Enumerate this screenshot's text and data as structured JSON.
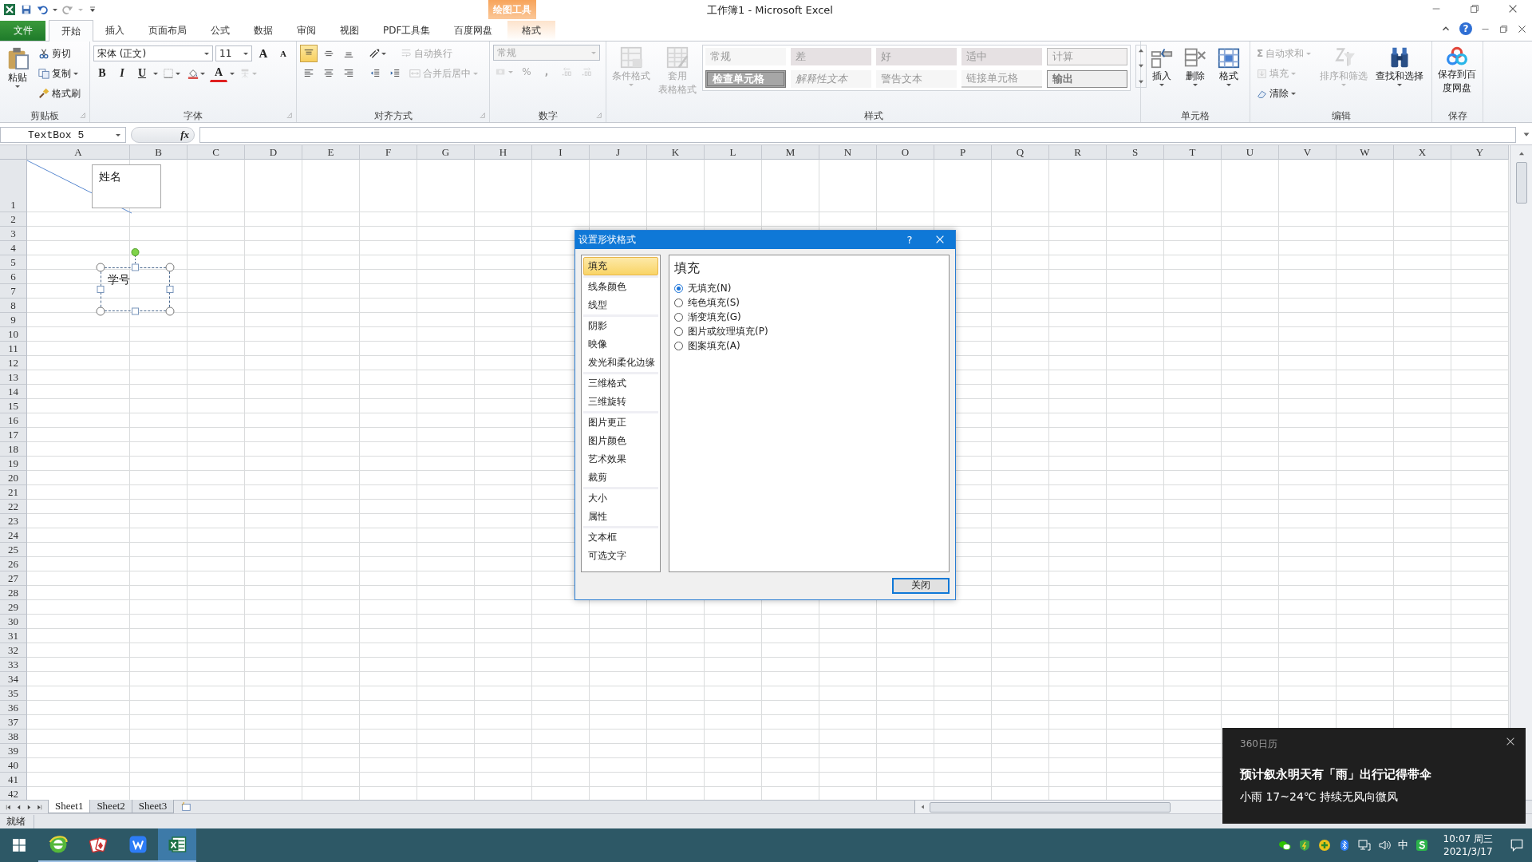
{
  "title_bar": {
    "title": "工作簿1 - Microsoft Excel",
    "contextual_header": "绘图工具",
    "help_label": "?"
  },
  "ribbon_tabs": [
    {
      "label": "文件",
      "kind": "file",
      "selected": false
    },
    {
      "label": "开始",
      "kind": "tab",
      "selected": true
    },
    {
      "label": "插入",
      "kind": "tab",
      "selected": false
    },
    {
      "label": "页面布局",
      "kind": "tab",
      "selected": false
    },
    {
      "label": "公式",
      "kind": "tab",
      "selected": false
    },
    {
      "label": "数据",
      "kind": "tab",
      "selected": false
    },
    {
      "label": "审阅",
      "kind": "tab",
      "selected": false
    },
    {
      "label": "视图",
      "kind": "tab",
      "selected": false
    },
    {
      "label": "PDF工具集",
      "kind": "tab",
      "selected": false
    },
    {
      "label": "百度网盘",
      "kind": "tab",
      "selected": false
    },
    {
      "label": "格式",
      "kind": "contextual",
      "selected": false
    }
  ],
  "clipboard": {
    "label": "剪贴板",
    "paste": "粘贴",
    "cut": "剪切",
    "copy": "复制",
    "format_painter": "格式刷"
  },
  "font": {
    "label": "字体",
    "font_name": "宋体 (正文)",
    "font_size": "11",
    "grow": "A",
    "shrink": "A",
    "font_color": "A",
    "phonetic_disabled": true,
    "styles": [
      {
        "label": "B",
        "kind": "bold"
      },
      {
        "label": "I",
        "kind": "italic"
      },
      {
        "label": "U",
        "kind": "underline"
      }
    ]
  },
  "alignment": {
    "label": "对齐方式",
    "vertical": [
      {
        "kind": "top",
        "selected": true
      },
      {
        "kind": "middle",
        "selected": false
      },
      {
        "kind": "bottom",
        "selected": false
      }
    ],
    "horizontal": [
      {
        "kind": "left",
        "selected": false
      },
      {
        "kind": "center",
        "selected": false
      },
      {
        "kind": "right",
        "selected": false
      }
    ],
    "wrap_text": {
      "label": "自动换行",
      "disabled": true
    },
    "merge_center": {
      "label": "合并后居中",
      "disabled": true
    }
  },
  "number": {
    "label": "数字",
    "format": "常规",
    "percent": "%",
    "comma": ",",
    "disabled": true
  },
  "styles": {
    "label": "样式",
    "conditional_format": "条件格式",
    "table_format_lines": [
      "套用",
      "表格格式"
    ],
    "disabled": true,
    "cell_styles": [
      {
        "label": "常规",
        "kind": "normal"
      },
      {
        "label": "差",
        "kind": "bad"
      },
      {
        "label": "好",
        "kind": "good"
      },
      {
        "label": "适中",
        "kind": "neutral"
      },
      {
        "label": "计算",
        "kind": "calculation"
      },
      {
        "label": "检查单元格",
        "kind": "check"
      },
      {
        "label": "解释性文本",
        "kind": "explanatory"
      },
      {
        "label": "警告文本",
        "kind": "warning"
      },
      {
        "label": "链接单元格",
        "kind": "linked"
      },
      {
        "label": "输出",
        "kind": "output"
      }
    ]
  },
  "cells": {
    "label": "单元格",
    "buttons": [
      {
        "label": "插入",
        "kind": "insert"
      },
      {
        "label": "删除",
        "kind": "delete"
      },
      {
        "label": "格式",
        "kind": "format"
      }
    ]
  },
  "editing": {
    "label": "编辑",
    "autosum_symbol": "Σ",
    "autosum": {
      "label": "自动求和",
      "disabled": true
    },
    "fill": {
      "label": "填充",
      "disabled": true
    },
    "clear": {
      "label": "清除",
      "disabled": false
    },
    "sort_filter": {
      "label": "排序和筛选",
      "disabled": true
    },
    "find_select": {
      "label": "查找和选择",
      "disabled": false
    }
  },
  "save": {
    "label": "保存",
    "button_lines": [
      "保存到百",
      "度网盘"
    ]
  },
  "formula_bar": {
    "name_box": "TextBox 5",
    "function_label": "fx"
  },
  "sheet": {
    "columns": [
      "A",
      "B",
      "C",
      "D",
      "E",
      "F",
      "G",
      "H",
      "I",
      "J",
      "K",
      "L",
      "M",
      "N",
      "O",
      "P",
      "Q",
      "R",
      "S",
      "T",
      "U",
      "V",
      "W",
      "X",
      "Y"
    ],
    "rows": [
      "1",
      "2",
      "3",
      "4",
      "5",
      "6",
      "7",
      "8",
      "9",
      "10",
      "11",
      "12",
      "13",
      "14",
      "15",
      "16",
      "17",
      "18",
      "19",
      "20",
      "21",
      "22",
      "23",
      "24",
      "25",
      "26",
      "27",
      "28",
      "29",
      "30",
      "31",
      "32",
      "33",
      "34",
      "35",
      "36",
      "37",
      "38",
      "39",
      "40",
      "41",
      "42"
    ],
    "shapes": [
      {
        "text": "姓名",
        "selected": false
      },
      {
        "text": "学号",
        "selected": true
      }
    ]
  },
  "sheet_tabs": [
    {
      "label": "Sheet1",
      "selected": true
    },
    {
      "label": "Sheet2",
      "selected": false
    },
    {
      "label": "Sheet3",
      "selected": false
    }
  ],
  "status_bar": {
    "text": "就绪"
  },
  "dialog": {
    "title": "设置形状格式",
    "help": "?",
    "heading": "填充",
    "close_button": "关闭",
    "category_groups": [
      {
        "items": [
          {
            "label": "填充",
            "selected": true
          }
        ]
      },
      {
        "items": [
          {
            "label": "线条颜色",
            "selected": false
          },
          {
            "label": "线型",
            "selected": false
          }
        ]
      },
      {
        "items": [
          {
            "label": "阴影",
            "selected": false
          },
          {
            "label": "映像",
            "selected": false
          },
          {
            "label": "发光和柔化边缘",
            "selected": false
          }
        ]
      },
      {
        "items": [
          {
            "label": "三维格式",
            "selected": false
          },
          {
            "label": "三维旋转",
            "selected": false
          }
        ]
      },
      {
        "items": [
          {
            "label": "图片更正",
            "selected": false
          },
          {
            "label": "图片颜色",
            "selected": false
          },
          {
            "label": "艺术效果",
            "selected": false
          },
          {
            "label": "裁剪",
            "selected": false
          }
        ]
      },
      {
        "items": [
          {
            "label": "大小",
            "selected": false
          },
          {
            "label": "属性",
            "selected": false
          }
        ]
      },
      {
        "items": [
          {
            "label": "文本框",
            "selected": false
          },
          {
            "label": "可选文字",
            "selected": false
          }
        ]
      }
    ],
    "fill_options": [
      {
        "label": "无填充(N)",
        "selected": true
      },
      {
        "label": "纯色填充(S)",
        "selected": false
      },
      {
        "label": "渐变填充(G)",
        "selected": false
      },
      {
        "label": "图片或纹理填充(P)",
        "selected": false
      },
      {
        "label": "图案填充(A)",
        "selected": false
      }
    ]
  },
  "notification": {
    "source": "360日历",
    "title": "预计叙永明天有「雨」出行记得带伞",
    "body": "小雨 17~24℃ 持续无风向微风"
  },
  "taskbar": {
    "apps": [
      {
        "kind": "browser",
        "running": true,
        "selected": false
      },
      {
        "kind": "cards",
        "running": true,
        "selected": false
      },
      {
        "kind": "wps",
        "running": true,
        "selected": false
      },
      {
        "kind": "excel",
        "running": true,
        "selected": true
      }
    ],
    "ime": "中",
    "time": "10:07 周三",
    "date": "2021/3/17"
  }
}
